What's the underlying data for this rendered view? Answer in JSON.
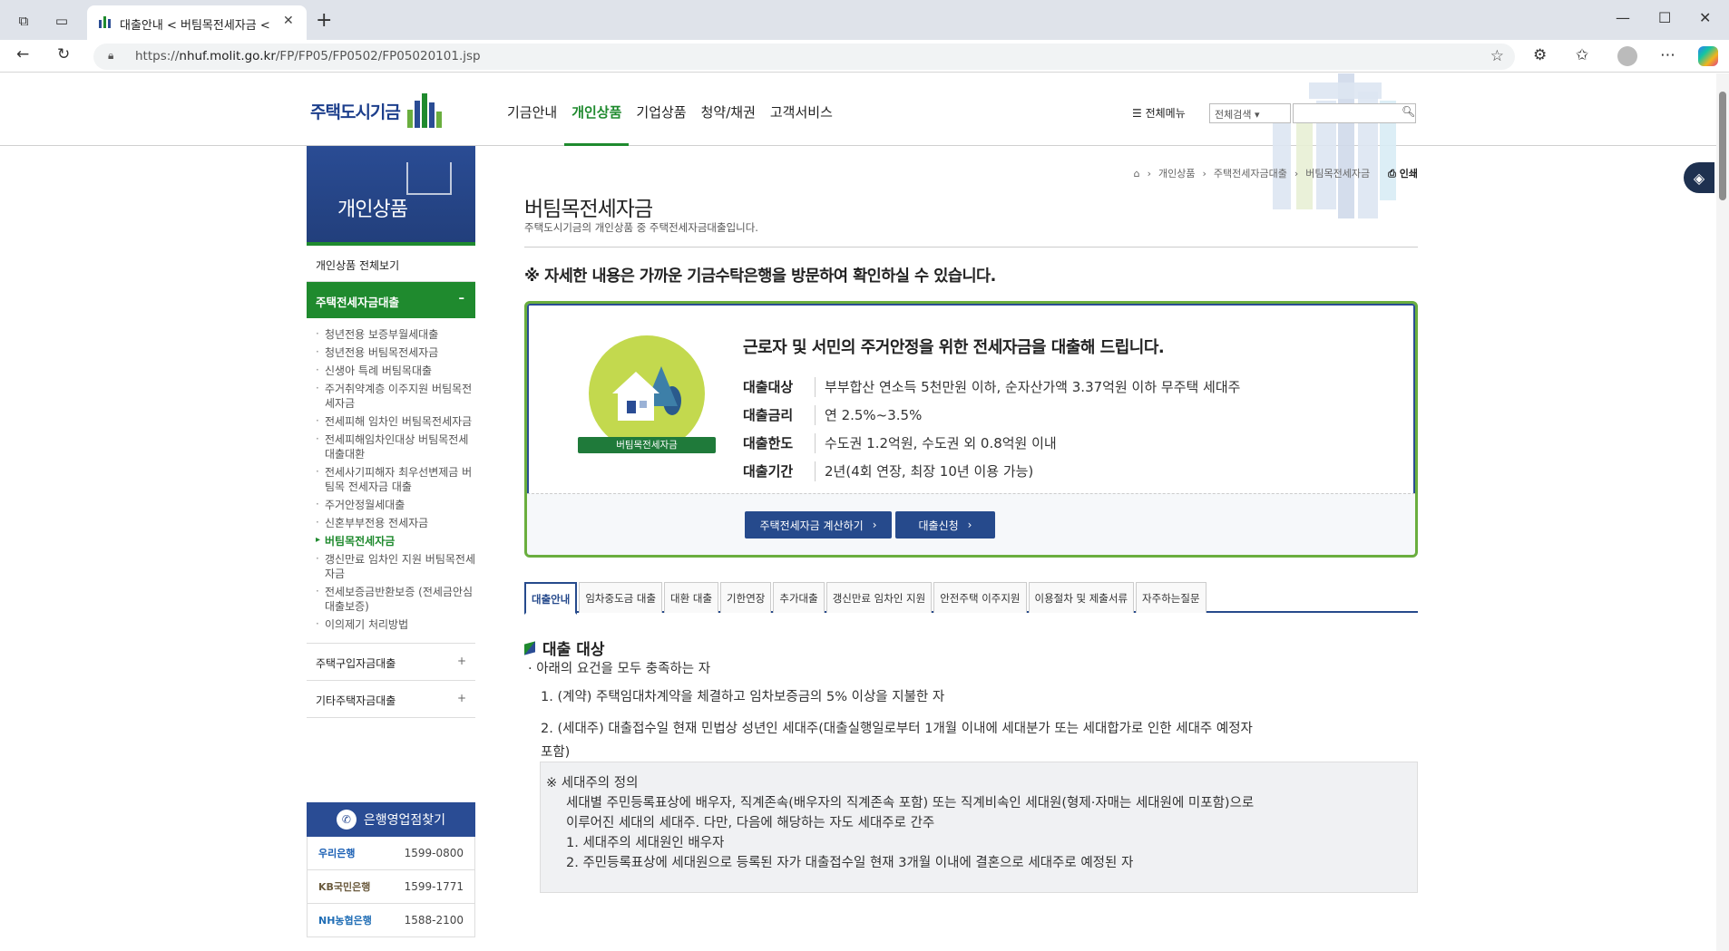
{
  "browser": {
    "tab_title": "대출안내 < 버팀목전세자금 < 주",
    "url_prefix": "https://",
    "url_host": "nhuf.molit.go.kr",
    "url_path": "/FP/FP05/FP0502/FP05020101.jsp"
  },
  "header": {
    "logo_text": "주택도시기금",
    "gnb": [
      "기금안내",
      "개인상품",
      "기업상품",
      "청약/채권",
      "고객서비스"
    ],
    "allmenu": "전체메뉴",
    "search_select": "전체검색"
  },
  "lnb": {
    "title": "개인상품",
    "all": "개인상품 전체보기",
    "current": "주택전세자금대출",
    "current_sign": "–",
    "sub_items": [
      "청년전용 보증부월세대출",
      "청년전용 버팀목전세자금",
      "신생아 특례 버팀목대출",
      "주거취약계층 이주지원 버팀목전세자금",
      "전세피해 임차인 버팀목전세자금",
      "전세피해임차인대상 버팀목전세대출대환",
      "전세사기피해자 최우선변제금 버팀목 전세자금 대출",
      "주거안정월세대출",
      "신혼부부전용 전세자금",
      "버팀목전세자금",
      "갱신만료 임차인 지원 버팀목전세자금",
      "전세보증금반환보증 (전세금안심대출보증)",
      "이의제기 처리방법"
    ],
    "folded": [
      "주택구입자금대출",
      "기타주택자금대출"
    ],
    "fold_sign": "+",
    "bank_title": "은행영업점찾기",
    "banks": [
      {
        "name": "우리은행",
        "tel": "1599-0800"
      },
      {
        "name": "KB국민은행",
        "tel": "1599-1771"
      },
      {
        "name": "NH농협은행",
        "tel": "1588-2100"
      }
    ]
  },
  "content": {
    "breadcrumb": [
      "개인상품",
      "주택전세자금대출",
      "버팀목전세자금"
    ],
    "print": "인쇄",
    "title": "버팀목전세자금",
    "desc": "주택도시기금의 개인상품 중 주택전세자금대출입니다.",
    "notice": "※ 자세한 내용은 가까운 기금수탁은행을 방문하여 확인하실 수 있습니다.",
    "info": {
      "badge": "버팀목전세자금",
      "headline": "근로자 및 서민의 주거안정을 위한 전세자금을 대출해 드립니다.",
      "rows": [
        {
          "key": "대출대상",
          "val": "부부합산 연소득 5천만원 이하, 순자산가액 3.37억원 이하 무주택 세대주"
        },
        {
          "key": "대출금리",
          "val": "연 2.5%~3.5%"
        },
        {
          "key": "대출한도",
          "val": "수도권 1.2억원, 수도권 외 0.8억원 이내"
        },
        {
          "key": "대출기간",
          "val": "2년(4회 연장, 최장 10년 이용 가능)"
        }
      ],
      "btn_calc": "주택전세자금 계산하기",
      "btn_apply": "대출신청"
    },
    "tabs": [
      "대출안내",
      "임차중도금 대출",
      "대환 대출",
      "기한연장",
      "추가대출",
      "갱신만료 임차인 지원",
      "안전주택 이주지원",
      "이용절차 및 제출서류",
      "자주하는질문"
    ],
    "section_title": "대출 대상",
    "bullet": "아래의 요건을 모두 충족하는 자",
    "item1": "1. (계약) 주택임대차계약을 체결하고 임차보증금의 5% 이상을 지불한 자",
    "item2a": "2. (세대주) 대출접수일 현재 민법상 성년인 세대주(대출실행일로부터 1개월 이내에 세대분가 또는 세대합가로 인한 세대주 예정자",
    "item2b": "포함)",
    "def_title": "※ 세대주의 정의",
    "def_lines": [
      "세대별 주민등록표상에 배우자, 직계존속(배우자의 직계존속 포함) 또는 직계비속인 세대원(형제·자매는 세대원에 미포함)으로",
      "이루어진 세대의 세대주. 다만, 다음에 해당하는 자도 세대주로 간주",
      "1. 세대주의 세대원인 배우자",
      "2. 주민등록표상에 세대원으로 등록된 자가 대출접수일 현재 3개월 이내에 결혼으로 세대주로 예정된 자"
    ]
  },
  "colors": {
    "green": "#1f8a2e",
    "navy": "#264a8c",
    "badge": "#c3d94e"
  }
}
